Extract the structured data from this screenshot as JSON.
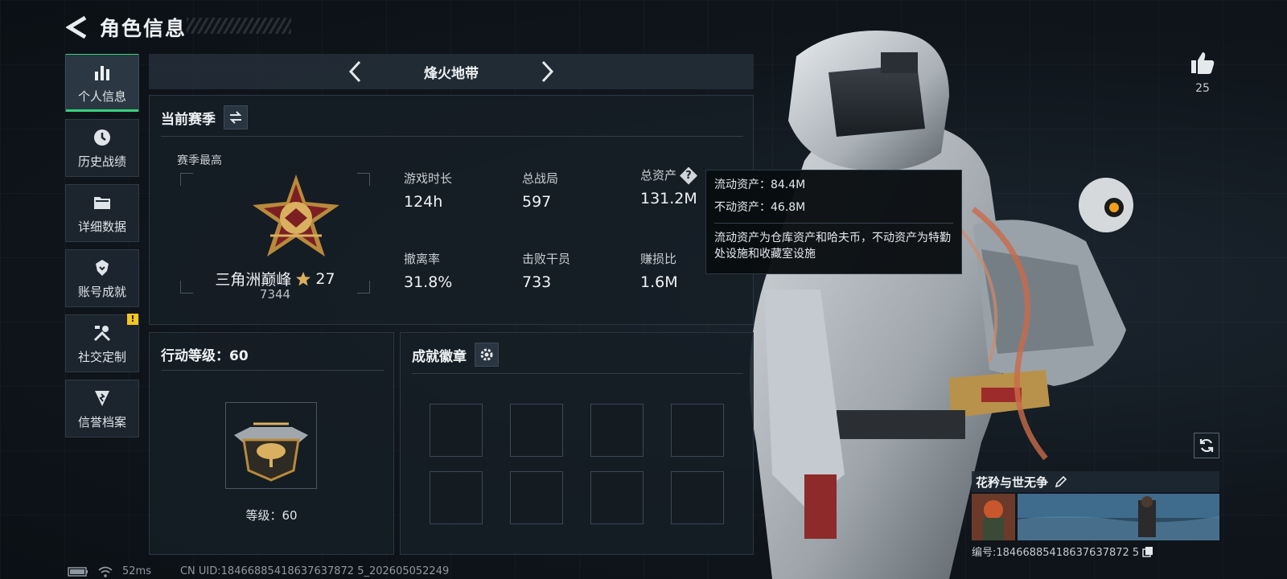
{
  "header": {
    "title": "角色信息"
  },
  "sidebar": {
    "items": [
      {
        "label": "个人信息",
        "icon": "bar-chart-icon"
      },
      {
        "label": "历史战绩",
        "icon": "history-icon"
      },
      {
        "label": "详细数据",
        "icon": "folder-icon"
      },
      {
        "label": "账号成就",
        "icon": "achievement-icon"
      },
      {
        "label": "社交定制",
        "icon": "tools-icon",
        "badge": "!"
      },
      {
        "label": "信誉档案",
        "icon": "shield-icon"
      }
    ]
  },
  "mode": {
    "title": "烽火地带"
  },
  "season": {
    "title": "当前赛季",
    "best_label": "赛季最高",
    "rank_name": "三角洲巅峰",
    "rank_stars": "27",
    "rank_score": "7344",
    "stats": [
      {
        "label": "游戏时长",
        "value": "124h"
      },
      {
        "label": "总战局",
        "value": "597"
      },
      {
        "label": "总资产",
        "value": "131.2M"
      },
      {
        "label": "撤离率",
        "value": "31.8%"
      },
      {
        "label": "击败干员",
        "value": "733"
      },
      {
        "label": "赚损比",
        "value": "1.6M"
      }
    ]
  },
  "tooltip": {
    "liquid": "流动资产：84.4M",
    "fixed": "不动资产：46.8M",
    "desc": "流动资产为仓库资产和哈夫币，不动资产为特勤处设施和收藏室设施"
  },
  "level": {
    "title": "行动等级：60",
    "label": "等级：60"
  },
  "achievements": {
    "title": "成就徽章"
  },
  "likes": {
    "count": "25"
  },
  "profile": {
    "name": "花矜与世无争",
    "uid": "编号:18466885418637637872 5"
  },
  "status": {
    "ping": "52ms",
    "cn_uid": "CN UID:18466885418637637872 5_202605052249"
  },
  "colors": {
    "accent": "#38d17c",
    "warn": "#f3c622"
  }
}
